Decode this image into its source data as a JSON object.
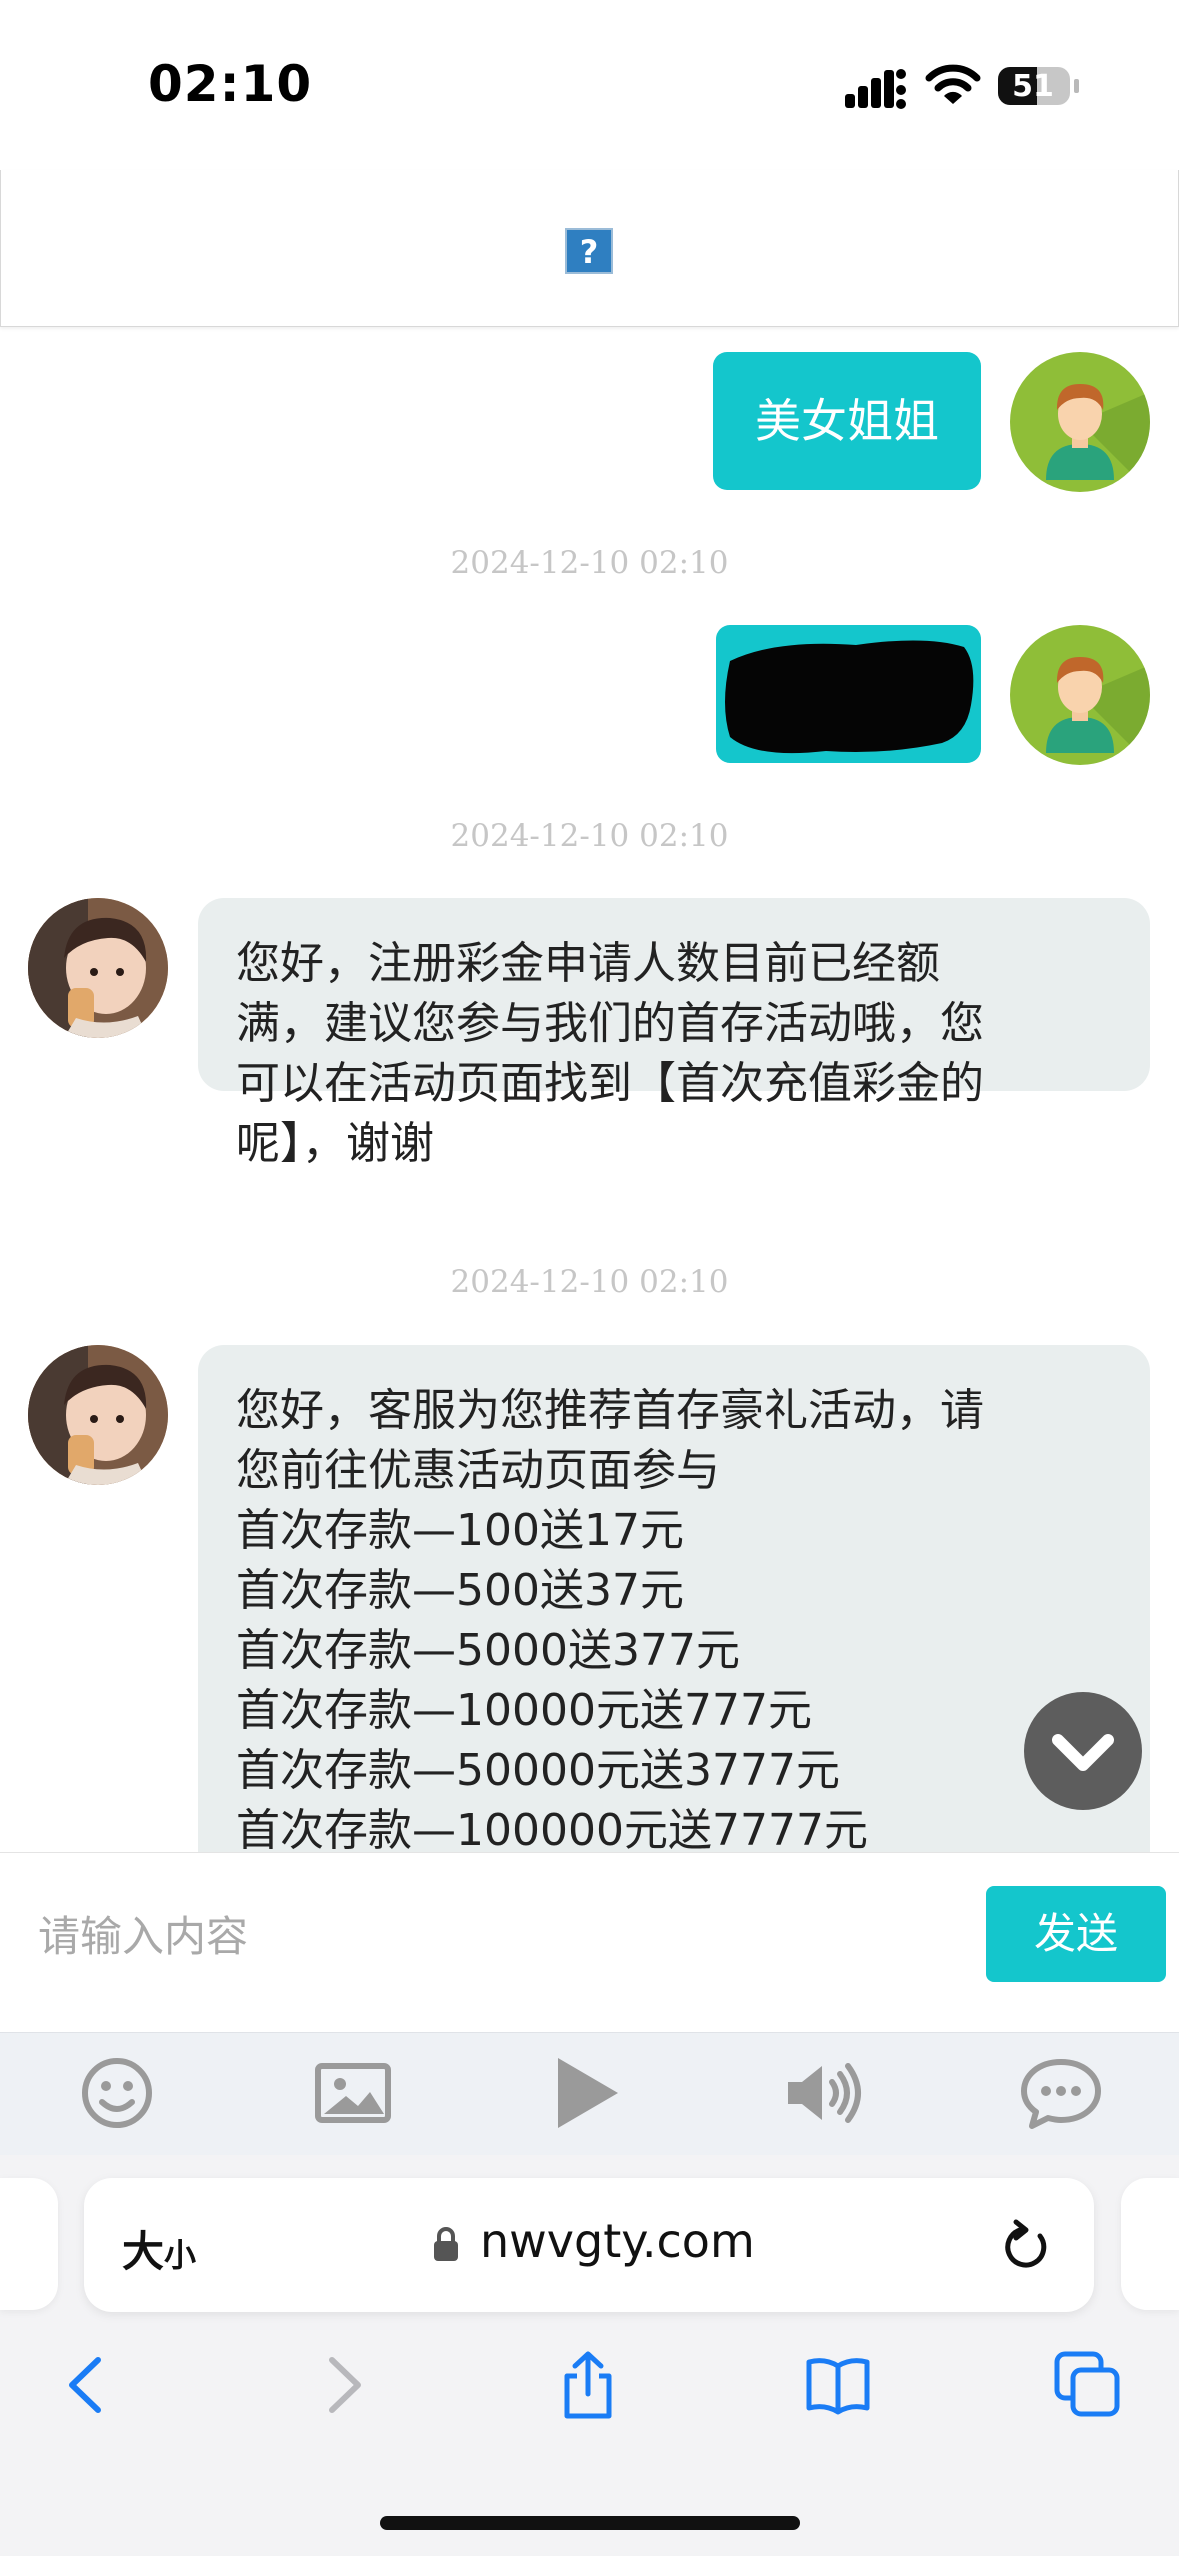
{
  "status_bar": {
    "time": "02:10",
    "battery_level": "51"
  },
  "header": {
    "broken_image_glyph": "?"
  },
  "messages": [
    {
      "direction": "outgoing",
      "type": "text",
      "text": "美女姐姐"
    },
    {
      "timestamp": "2024-12-10 02:10"
    },
    {
      "direction": "outgoing",
      "type": "redacted"
    },
    {
      "timestamp": "2024-12-10 02:10"
    },
    {
      "direction": "incoming",
      "lines": [
        "您好，注册彩金申请人数目前已经额",
        "满，建议您参与我们的首存活动哦，您",
        "可以在活动页面找到【首次充值彩金的",
        "呢】，谢谢"
      ]
    },
    {
      "timestamp": "2024-12-10 02:10"
    },
    {
      "direction": "incoming",
      "lines": [
        "您好，客服为您推荐首存豪礼活动，请",
        "您前往优惠活动页面参与",
        "首次存款—100送17元",
        "首次存款—500送37元",
        "首次存款—5000送377元",
        "首次存款—10000元送777元",
        "首次存款—50000元送3777元",
        "首次存款—100000元送7777元"
      ]
    }
  ],
  "input": {
    "placeholder": "请输入内容",
    "send_label": "发送"
  },
  "toolbar": {
    "icons": [
      "emoji-icon",
      "image-icon",
      "video-play-icon",
      "voice-icon",
      "chat-bubble-icon"
    ]
  },
  "browser": {
    "text_size_label": "大",
    "text_size_small": "小",
    "url": "nwvgty.com"
  },
  "colors": {
    "accent": "#14c6cc",
    "agent_avatar": "#8fbe38",
    "incoming_bubble": "#e9eeee",
    "timestamp": "#c6c6c6",
    "safari_blue": "#1a7cf5"
  }
}
